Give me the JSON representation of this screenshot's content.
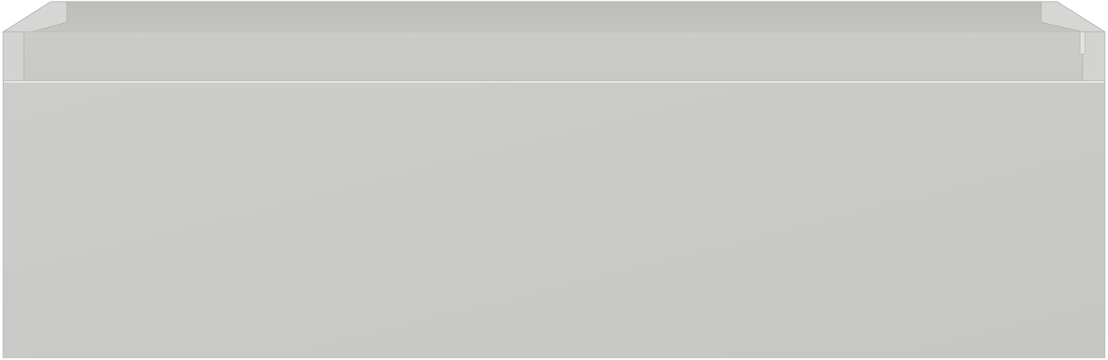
{
  "image": {
    "subject": "drawer",
    "colors": {
      "background": "#ffffff",
      "front_panel": "#cbcbc9",
      "front_panel_dark": "#c7c7c5",
      "inner_back_wall": "#c2c2c0",
      "inner_back_top": "#bababa",
      "inner_floor": "#c9c9c7",
      "side_wall": "#d6d6d4",
      "edge_highlight": "#e6e6e4",
      "outline": "#b3b3b1"
    }
  }
}
